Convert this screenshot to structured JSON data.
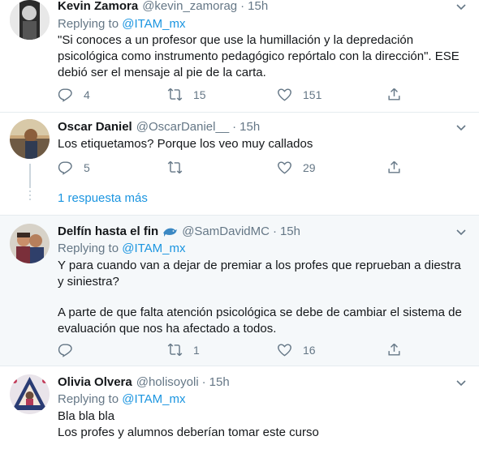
{
  "tweets": [
    {
      "name": "Kevin Zamora",
      "handle": "@kevin_zamorag",
      "dot": "·",
      "time": "15h",
      "replying_prefix": "Replying to",
      "replying_to": "@ITAM_mx",
      "text": "\"Si conoces a un profesor que use la humillación y la depredación psicológica como instrumento pedagógico repórtalo con la dirección\". ESE debió ser el mensaje al pie de la carta.",
      "replies": "4",
      "retweets": "15",
      "likes": "151"
    },
    {
      "name": "Oscar Daniel",
      "handle": "@OscarDaniel__",
      "dot": "·",
      "time": "15h",
      "text": "Los etiquetamos? Porque los veo muy callados",
      "replies": "5",
      "retweets": "",
      "likes": "29"
    },
    {
      "name": "Delfín hasta el fin",
      "handle": "@SamDavidMC",
      "dot": "·",
      "time": "15h",
      "replying_prefix": "Replying to",
      "replying_to": "@ITAM_mx",
      "text_p1": "Y para cuando van a dejar de premiar a los profes que reprueban a diestra y siniestra?",
      "text_p2": "A parte de que falta atención psicológica se debe de cambiar el sistema de evaluación que nos ha afectado a todos.",
      "replies": "",
      "retweets": "1",
      "likes": "16"
    },
    {
      "name": "Olivia Olvera",
      "handle": "@holisoyoli",
      "dot": "·",
      "time": "15h",
      "replying_prefix": "Replying to",
      "replying_to": "@ITAM_mx",
      "text_l1": "Bla bla bla",
      "text_l2": "Los profes y alumnos deberían tomar este curso"
    }
  ],
  "thread_more": "1 respuesta más",
  "icons": {
    "reply": "reply-icon",
    "retweet": "retweet-icon",
    "like": "heart-icon",
    "share": "share-icon",
    "caret": "chevron-down-icon",
    "emoji": "dolphin-emoji"
  },
  "colors": {
    "link": "#1b95e0",
    "secondary": "#657786",
    "highlight_bg": "#f5f8fa"
  }
}
